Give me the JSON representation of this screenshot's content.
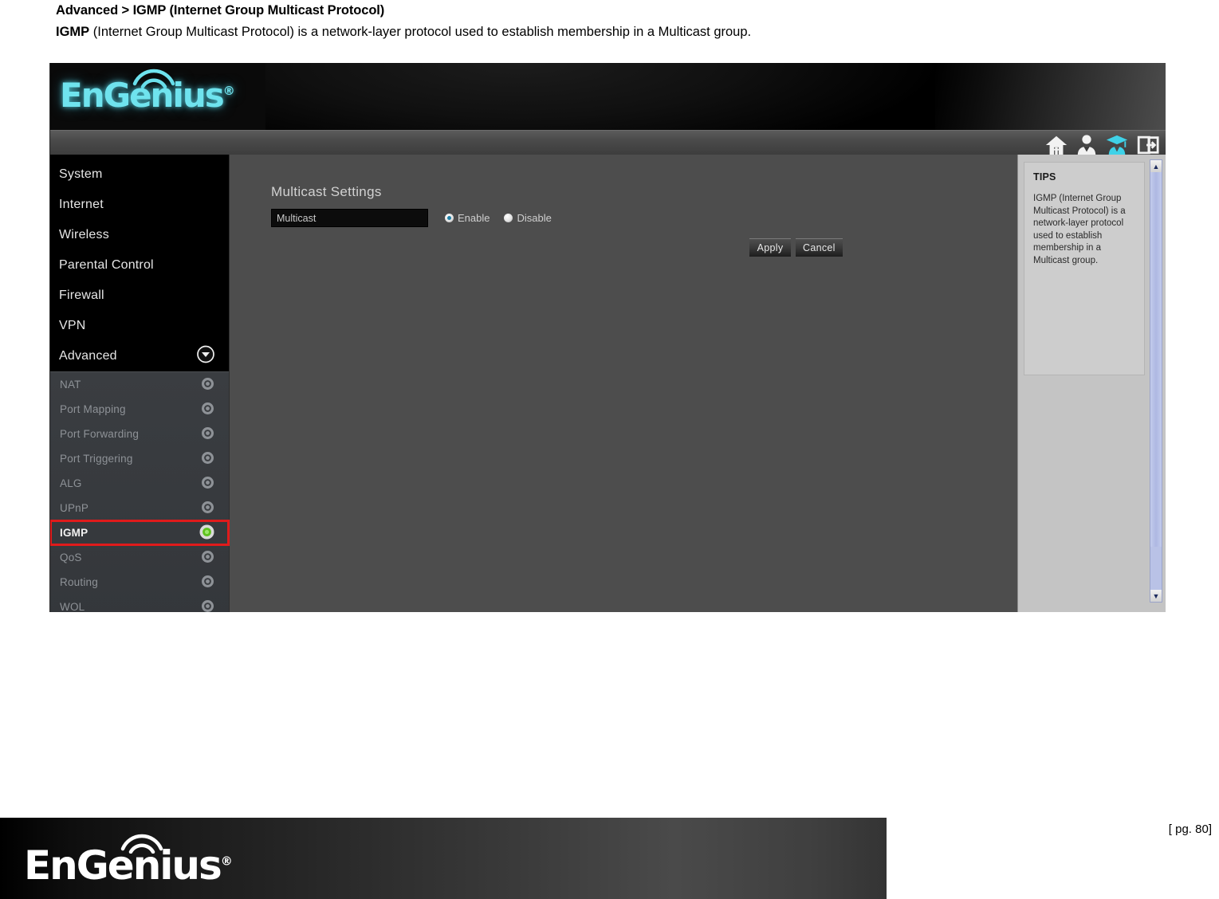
{
  "document": {
    "breadcrumb_title": "Advanced > IGMP (Internet Group Multicast Protocol)",
    "description_bold": "IGMP",
    "description_rest": " (Internet Group Multicast Protocol) is a network-layer protocol used to establish membership in a Multicast group.",
    "page_number": "[ pg. 80]"
  },
  "brand": {
    "name": "EnGenius",
    "registered_mark": "®",
    "logo_color_header": "#6fe3ee",
    "logo_color_footer": "#ffffff"
  },
  "toolbar": {
    "icons": [
      {
        "name": "home-icon",
        "label": "Home"
      },
      {
        "name": "user-account-icon",
        "label": "Account"
      },
      {
        "name": "wizard-graduate-icon",
        "label": "Wizard",
        "color": "#3fd2e8",
        "active": true
      },
      {
        "name": "logout-icon",
        "label": "Logout"
      }
    ]
  },
  "sidebar": {
    "main_items": [
      {
        "label": "System",
        "icon": ""
      },
      {
        "label": "Internet",
        "icon": ""
      },
      {
        "label": "Wireless",
        "icon": ""
      },
      {
        "label": "Parental Control",
        "icon": ""
      },
      {
        "label": "Firewall",
        "icon": ""
      },
      {
        "label": "VPN",
        "icon": ""
      },
      {
        "label": "Advanced",
        "icon": "chevron-down-icon",
        "expanded": true
      }
    ],
    "sub_items": [
      {
        "label": "NAT",
        "active": false
      },
      {
        "label": "Port Mapping",
        "active": false
      },
      {
        "label": "Port Forwarding",
        "active": false
      },
      {
        "label": "Port Triggering",
        "active": false
      },
      {
        "label": "ALG",
        "active": false
      },
      {
        "label": "UPnP",
        "active": false
      },
      {
        "label": "IGMP",
        "active": true
      },
      {
        "label": "QoS",
        "active": false
      },
      {
        "label": "Routing",
        "active": false
      },
      {
        "label": "WOL",
        "active": false
      }
    ],
    "highlight_color": "#e01b1b",
    "active_dot_color": "#5fc11e"
  },
  "content": {
    "section_title": "Multicast Settings",
    "field_label": "Multicast",
    "radio_options": [
      {
        "label": "Enable",
        "selected": true
      },
      {
        "label": "Disable",
        "selected": false
      }
    ],
    "buttons": [
      {
        "label": "Apply"
      },
      {
        "label": "Cancel"
      }
    ]
  },
  "tips": {
    "title": "TIPS",
    "body": "IGMP (Internet Group Multicast Protocol) is a network-layer protocol used to establish membership in a Multicast group.",
    "scroll_up": "▲",
    "scroll_down": "▼"
  }
}
